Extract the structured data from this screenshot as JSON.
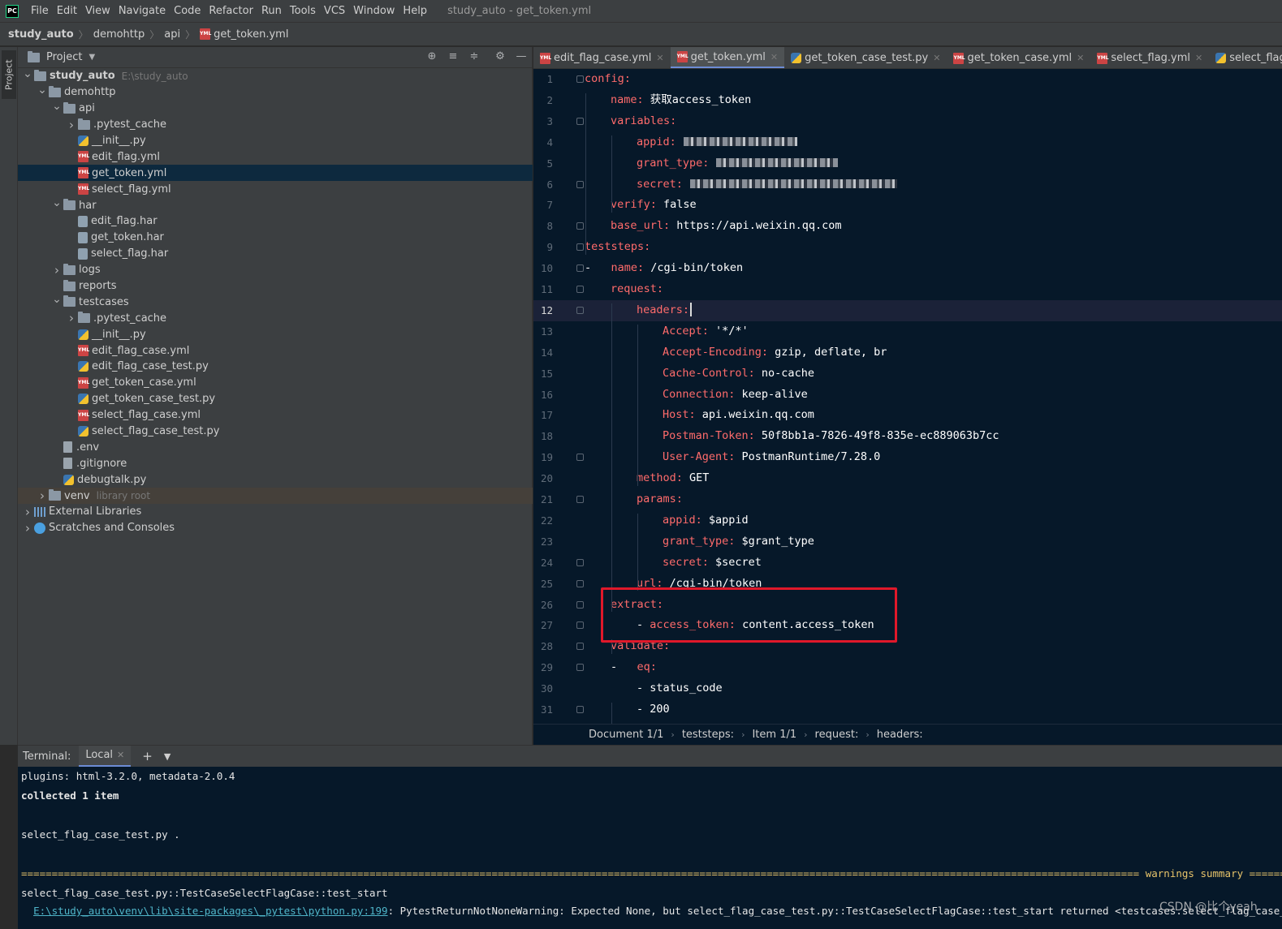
{
  "app": {
    "logo": "PC",
    "window_title": "study_auto - get_token.yml",
    "menu": [
      "File",
      "Edit",
      "View",
      "Navigate",
      "Code",
      "Refactor",
      "Run",
      "Tools",
      "VCS",
      "Window",
      "Help"
    ]
  },
  "breadcrumb": [
    "study_auto",
    "demohttp",
    "api",
    "get_token.yml"
  ],
  "toolstrip": {
    "project_tab": "Project"
  },
  "project_panel": {
    "title": "Project",
    "tree": [
      {
        "label": "study_auto",
        "hint": "E:\\study_auto",
        "indent": 0,
        "arrow": "down",
        "icon": "folder",
        "bold": true
      },
      {
        "label": "demohttp",
        "indent": 1,
        "arrow": "down",
        "icon": "folder"
      },
      {
        "label": "api",
        "indent": 2,
        "arrow": "down",
        "icon": "folder"
      },
      {
        "label": ".pytest_cache",
        "indent": 3,
        "arrow": "right",
        "icon": "folder"
      },
      {
        "label": "__init__.py",
        "indent": 3,
        "icon": "py"
      },
      {
        "label": "edit_flag.yml",
        "indent": 3,
        "icon": "yml"
      },
      {
        "label": "get_token.yml",
        "indent": 3,
        "icon": "yml",
        "selected": true
      },
      {
        "label": "select_flag.yml",
        "indent": 3,
        "icon": "yml"
      },
      {
        "label": "har",
        "indent": 2,
        "arrow": "down",
        "icon": "folder"
      },
      {
        "label": "edit_flag.har",
        "indent": 3,
        "icon": "har"
      },
      {
        "label": "get_token.har",
        "indent": 3,
        "icon": "har"
      },
      {
        "label": "select_flag.har",
        "indent": 3,
        "icon": "har"
      },
      {
        "label": "logs",
        "indent": 2,
        "arrow": "right",
        "icon": "folder"
      },
      {
        "label": "reports",
        "indent": 2,
        "icon": "folder"
      },
      {
        "label": "testcases",
        "indent": 2,
        "arrow": "down",
        "icon": "folder"
      },
      {
        "label": ".pytest_cache",
        "indent": 3,
        "arrow": "right",
        "icon": "folder"
      },
      {
        "label": "__init__.py",
        "indent": 3,
        "icon": "py"
      },
      {
        "label": "edit_flag_case.yml",
        "indent": 3,
        "icon": "yml"
      },
      {
        "label": "edit_flag_case_test.py",
        "indent": 3,
        "icon": "py"
      },
      {
        "label": "get_token_case.yml",
        "indent": 3,
        "icon": "yml"
      },
      {
        "label": "get_token_case_test.py",
        "indent": 3,
        "icon": "py"
      },
      {
        "label": "select_flag_case.yml",
        "indent": 3,
        "icon": "yml"
      },
      {
        "label": "select_flag_case_test.py",
        "indent": 3,
        "icon": "py"
      },
      {
        "label": ".env",
        "indent": 2,
        "icon": "file"
      },
      {
        "label": ".gitignore",
        "indent": 2,
        "icon": "file"
      },
      {
        "label": "debugtalk.py",
        "indent": 2,
        "icon": "py"
      },
      {
        "label": "venv",
        "hint": "library root",
        "indent": 1,
        "arrow": "right",
        "icon": "folder",
        "venv": true
      },
      {
        "label": "External Libraries",
        "indent": 0,
        "arrow": "right",
        "icon": "lib"
      },
      {
        "label": "Scratches and Consoles",
        "indent": 0,
        "arrow": "right",
        "icon": "scratch"
      }
    ]
  },
  "editor_tabs": [
    {
      "label": "edit_flag_case.yml",
      "icon": "yml"
    },
    {
      "label": "get_token.yml",
      "icon": "yml",
      "active": true
    },
    {
      "label": "get_token_case_test.py",
      "icon": "py"
    },
    {
      "label": "get_token_case.yml",
      "icon": "yml"
    },
    {
      "label": "select_flag.yml",
      "icon": "yml"
    },
    {
      "label": "select_flag_case_test.py",
      "icon": "py"
    }
  ],
  "code_lines": [
    {
      "n": "1",
      "indent": 0,
      "key": "config:",
      "val": "",
      "fold": true
    },
    {
      "n": "2",
      "indent": 1,
      "key": "name:",
      "val": " 获取access_token"
    },
    {
      "n": "3",
      "indent": 1,
      "key": "variables:",
      "val": "",
      "fold": true
    },
    {
      "n": "4",
      "indent": 2,
      "key": "appid:",
      "val": "",
      "redacted": true
    },
    {
      "n": "5",
      "indent": 2,
      "key": "grant_type:",
      "val": "",
      "redacted": true
    },
    {
      "n": "6",
      "indent": 2,
      "key": "secret:",
      "val": "",
      "redacted": true,
      "fold": true
    },
    {
      "n": "7",
      "indent": 1,
      "key": "verify:",
      "val": " false"
    },
    {
      "n": "8",
      "indent": 1,
      "key": "base_url:",
      "val": " https://api.weixin.qq.com",
      "fold": true
    },
    {
      "n": "9",
      "indent": 0,
      "key": "teststeps:",
      "val": "",
      "fold": true
    },
    {
      "n": "10",
      "indent": 0,
      "prefix": "-   ",
      "key": "name:",
      "val": " /cgi-bin/token",
      "fold": true
    },
    {
      "n": "11",
      "indent": 1,
      "key": "request:",
      "val": "",
      "fold": true
    },
    {
      "n": "12",
      "indent": 2,
      "key": "headers:",
      "val": "",
      "fold": true,
      "current": true
    },
    {
      "n": "13",
      "indent": 3,
      "key": "Accept:",
      "val": " '*/*'"
    },
    {
      "n": "14",
      "indent": 3,
      "key": "Accept-Encoding:",
      "val": " gzip, deflate, br"
    },
    {
      "n": "15",
      "indent": 3,
      "key": "Cache-Control:",
      "val": " no-cache"
    },
    {
      "n": "16",
      "indent": 3,
      "key": "Connection:",
      "val": " keep-alive"
    },
    {
      "n": "17",
      "indent": 3,
      "key": "Host:",
      "val": " api.weixin.qq.com"
    },
    {
      "n": "18",
      "indent": 3,
      "key": "Postman-Token:",
      "val": " 50f8bb1a-7826-49f8-835e-ec889063b7cc"
    },
    {
      "n": "19",
      "indent": 3,
      "key": "User-Agent:",
      "val": " PostmanRuntime/7.28.0",
      "fold": true
    },
    {
      "n": "20",
      "indent": 2,
      "key": "method:",
      "val": " GET"
    },
    {
      "n": "21",
      "indent": 2,
      "key": "params:",
      "val": "",
      "fold": true
    },
    {
      "n": "22",
      "indent": 3,
      "key": "appid:",
      "val": " $appid"
    },
    {
      "n": "23",
      "indent": 3,
      "key": "grant_type:",
      "val": " $grant_type"
    },
    {
      "n": "24",
      "indent": 3,
      "key": "secret:",
      "val": " $secret",
      "fold": true
    },
    {
      "n": "25",
      "indent": 2,
      "key": "url:",
      "val": " /cgi-bin/token",
      "fold": true
    },
    {
      "n": "26",
      "indent": 1,
      "key": "extract:",
      "val": "",
      "fold": true
    },
    {
      "n": "27",
      "indent": 2,
      "prefix": "- ",
      "key": "access_token:",
      "val": " content.access_token",
      "fold": true
    },
    {
      "n": "28",
      "indent": 1,
      "key": "validate:",
      "val": "",
      "fold": true
    },
    {
      "n": "29",
      "indent": 1,
      "prefix": "-   ",
      "key": "eq:",
      "val": "",
      "fold": true
    },
    {
      "n": "30",
      "indent": 2,
      "key": "",
      "val": "- status_code"
    },
    {
      "n": "31",
      "indent": 2,
      "key": "",
      "val": "- 200",
      "fold": true
    }
  ],
  "editor_footer": [
    "Document 1/1",
    "teststeps:",
    "Item 1/1",
    "request:",
    "headers:"
  ],
  "terminal": {
    "title": "Terminal:",
    "tab": "Local",
    "lines": [
      {
        "text": "plugins: html-3.2.0, metadata-2.0.4",
        "style": ""
      },
      {
        "text": "collected 1 item",
        "style": "bold"
      },
      {
        "text": "",
        "style": ""
      },
      {
        "text": "select_flag_case_test.py .",
        "style": ""
      },
      {
        "text": "",
        "style": ""
      },
      {
        "text": "======================================================================================================================================================================================= warnings summary ==========================================================================================",
        "style": "warn"
      },
      {
        "text": "select_flag_case_test.py::TestCaseSelectFlagCase::test_start",
        "style": ""
      }
    ],
    "last_line_link": "E:\\study_auto\\venv\\lib\\site-packages\\_pytest\\python.py:199",
    "last_line_text": ": PytestReturnNotNoneWarning: Expected None, but select_flag_case_test.py::TestCaseSelectFlagCase::test_start returned <testcases.select_flag_case_test.TestCaseSe"
  },
  "watermark": "CSDN @比个yeah"
}
